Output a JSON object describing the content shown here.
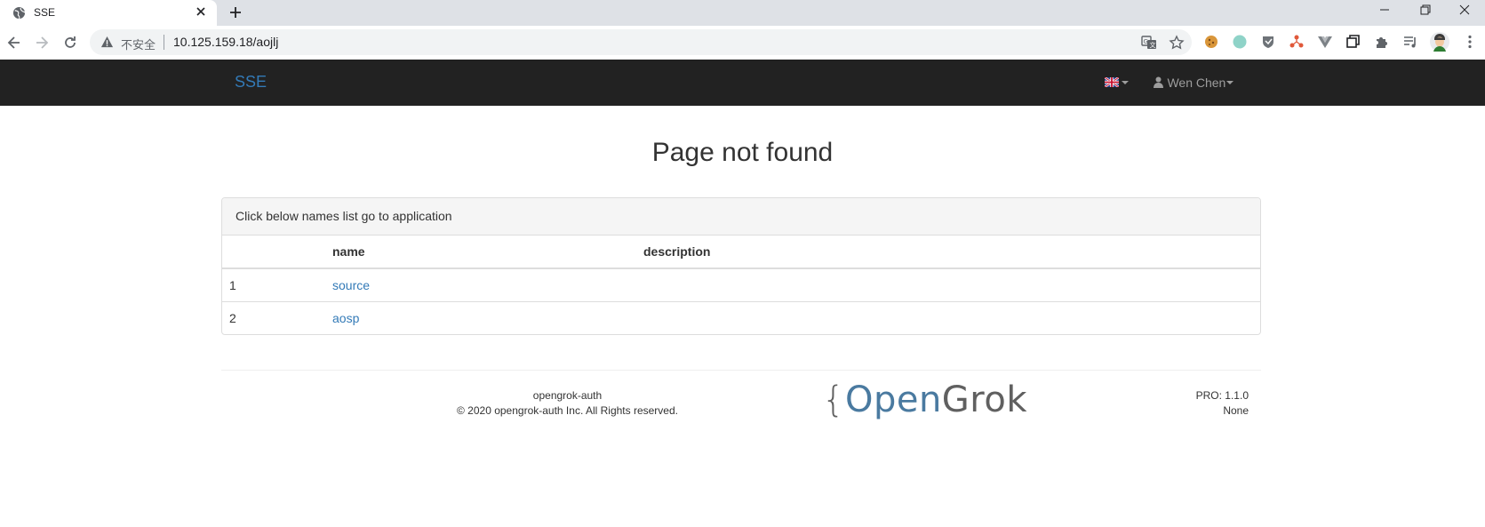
{
  "browser": {
    "tab_title": "SSE",
    "omnibox": {
      "insecure_label": "不安全",
      "url": "10.125.159.18/aojlj"
    }
  },
  "navbar": {
    "brand": "SSE",
    "language_icon": "uk-flag-icon",
    "user_name": "Wen Chen"
  },
  "main": {
    "title": "Page not found",
    "panel": {
      "heading": "Click below names list go to application",
      "columns": [
        "",
        "name",
        "description"
      ],
      "rows": [
        {
          "index": "1",
          "name": "source",
          "description": ""
        },
        {
          "index": "2",
          "name": "aosp",
          "description": ""
        }
      ]
    }
  },
  "footer": {
    "app_name": "opengrok-auth",
    "copyright": "© 2020 opengrok-auth Inc. All Rights reserved.",
    "logo": {
      "brace": "{",
      "part1": "Open",
      "part2": "Grok"
    },
    "version": "PRO: 1.1.0",
    "extra": "None"
  },
  "colors": {
    "navbar_bg": "#222222",
    "link": "#337ab7",
    "navbar_text": "#9d9d9d",
    "logo_blue": "#4a7aa0",
    "logo_gray": "#606060"
  }
}
